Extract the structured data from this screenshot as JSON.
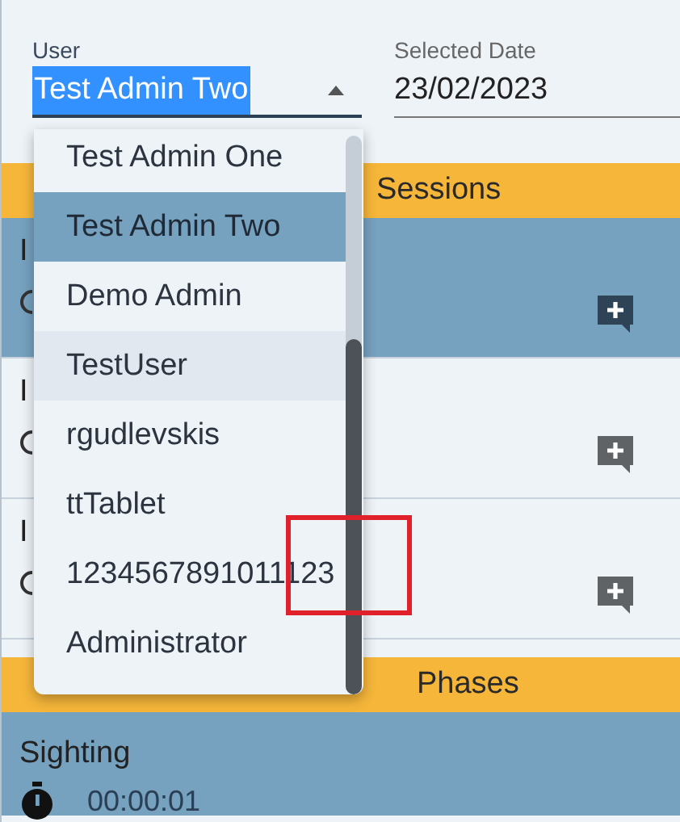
{
  "user_field": {
    "label": "User",
    "value": "Test Admin Two",
    "expanded": true
  },
  "date_field": {
    "label": "Selected Date",
    "value": "23/02/2023"
  },
  "sessions_header": "Sessions",
  "sessions": [
    {
      "title": "I",
      "selected": true
    },
    {
      "title": "I",
      "selected": false
    },
    {
      "title": "I",
      "selected": false
    }
  ],
  "phases_header": "Phases",
  "phases": [
    {
      "name": "Sighting",
      "time": "00:00:01",
      "selected": true
    }
  ],
  "user_options": [
    {
      "label": "Test Admin One",
      "selected": false,
      "hovered": false
    },
    {
      "label": "Test Admin Two",
      "selected": true,
      "hovered": false
    },
    {
      "label": "Demo Admin",
      "selected": false,
      "hovered": false
    },
    {
      "label": "TestUser",
      "selected": false,
      "hovered": true
    },
    {
      "label": "rgudlevskis",
      "selected": false,
      "hovered": false
    },
    {
      "label": "ttTablet",
      "selected": false,
      "hovered": false
    },
    {
      "label": "1234567891011123",
      "selected": false,
      "hovered": false
    },
    {
      "label": "Administrator",
      "selected": false,
      "hovered": false
    }
  ]
}
